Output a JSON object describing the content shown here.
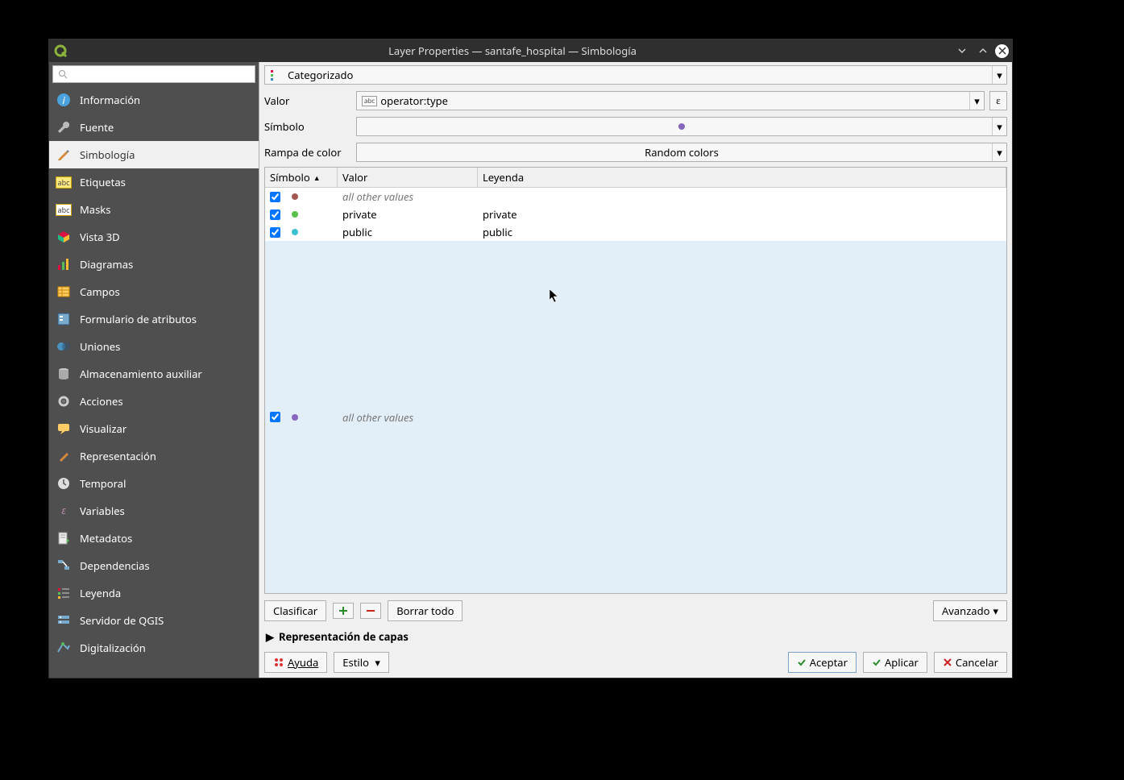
{
  "window": {
    "title": "Layer Properties — santafe_hospital — Simbología"
  },
  "search": {
    "placeholder": ""
  },
  "sidebar": [
    {
      "label": "Información",
      "icon": "info"
    },
    {
      "label": "Fuente",
      "icon": "wrench"
    },
    {
      "label": "Simbología",
      "icon": "brush",
      "active": true
    },
    {
      "label": "Etiquetas",
      "icon": "tag"
    },
    {
      "label": "Masks",
      "icon": "abc"
    },
    {
      "label": "Vista 3D",
      "icon": "cube"
    },
    {
      "label": "Diagramas",
      "icon": "chart"
    },
    {
      "label": "Campos",
      "icon": "fields"
    },
    {
      "label": "Formulario de atributos",
      "icon": "form"
    },
    {
      "label": "Uniones",
      "icon": "join"
    },
    {
      "label": "Almacenamiento auxiliar",
      "icon": "db"
    },
    {
      "label": "Acciones",
      "icon": "gear"
    },
    {
      "label": "Visualizar",
      "icon": "tip"
    },
    {
      "label": "Representación",
      "icon": "paint"
    },
    {
      "label": "Temporal",
      "icon": "clock"
    },
    {
      "label": "Variables",
      "icon": "var"
    },
    {
      "label": "Metadatos",
      "icon": "meta"
    },
    {
      "label": "Dependencias",
      "icon": "dep"
    },
    {
      "label": "Leyenda",
      "icon": "legend"
    },
    {
      "label": "Servidor de QGIS",
      "icon": "server"
    },
    {
      "label": "Digitalización",
      "icon": "digit"
    }
  ],
  "styleType": "Categorizado",
  "labels": {
    "valor": "Valor",
    "simbolo": "Símbolo",
    "rampa": "Rampa de color"
  },
  "value": "operator:type",
  "rampa": "Random colors",
  "tableHeaders": {
    "simbolo": "Símbolo",
    "valor": "Valor",
    "leyenda": "Leyenda"
  },
  "rows": [
    {
      "checked": true,
      "color": "#a05850",
      "value": "all other values",
      "legend": "",
      "italic": true
    },
    {
      "checked": true,
      "color": "#5bbf4e",
      "value": "private",
      "legend": "private"
    },
    {
      "checked": true,
      "color": "#3fc0d0",
      "value": "public",
      "legend": "public"
    },
    {
      "checked": true,
      "color": "#8866c0",
      "value": "all other values",
      "legend": "",
      "italic": true,
      "selected": true
    }
  ],
  "buttons": {
    "classify": "Clasificar",
    "deleteAll": "Borrar todo",
    "advanced": "Avanzado"
  },
  "collapse": "Representación de capas",
  "footer": {
    "help": "Ayuda",
    "style": "Estilo",
    "accept": "Aceptar",
    "apply": "Aplicar",
    "cancel": "Cancelar"
  }
}
